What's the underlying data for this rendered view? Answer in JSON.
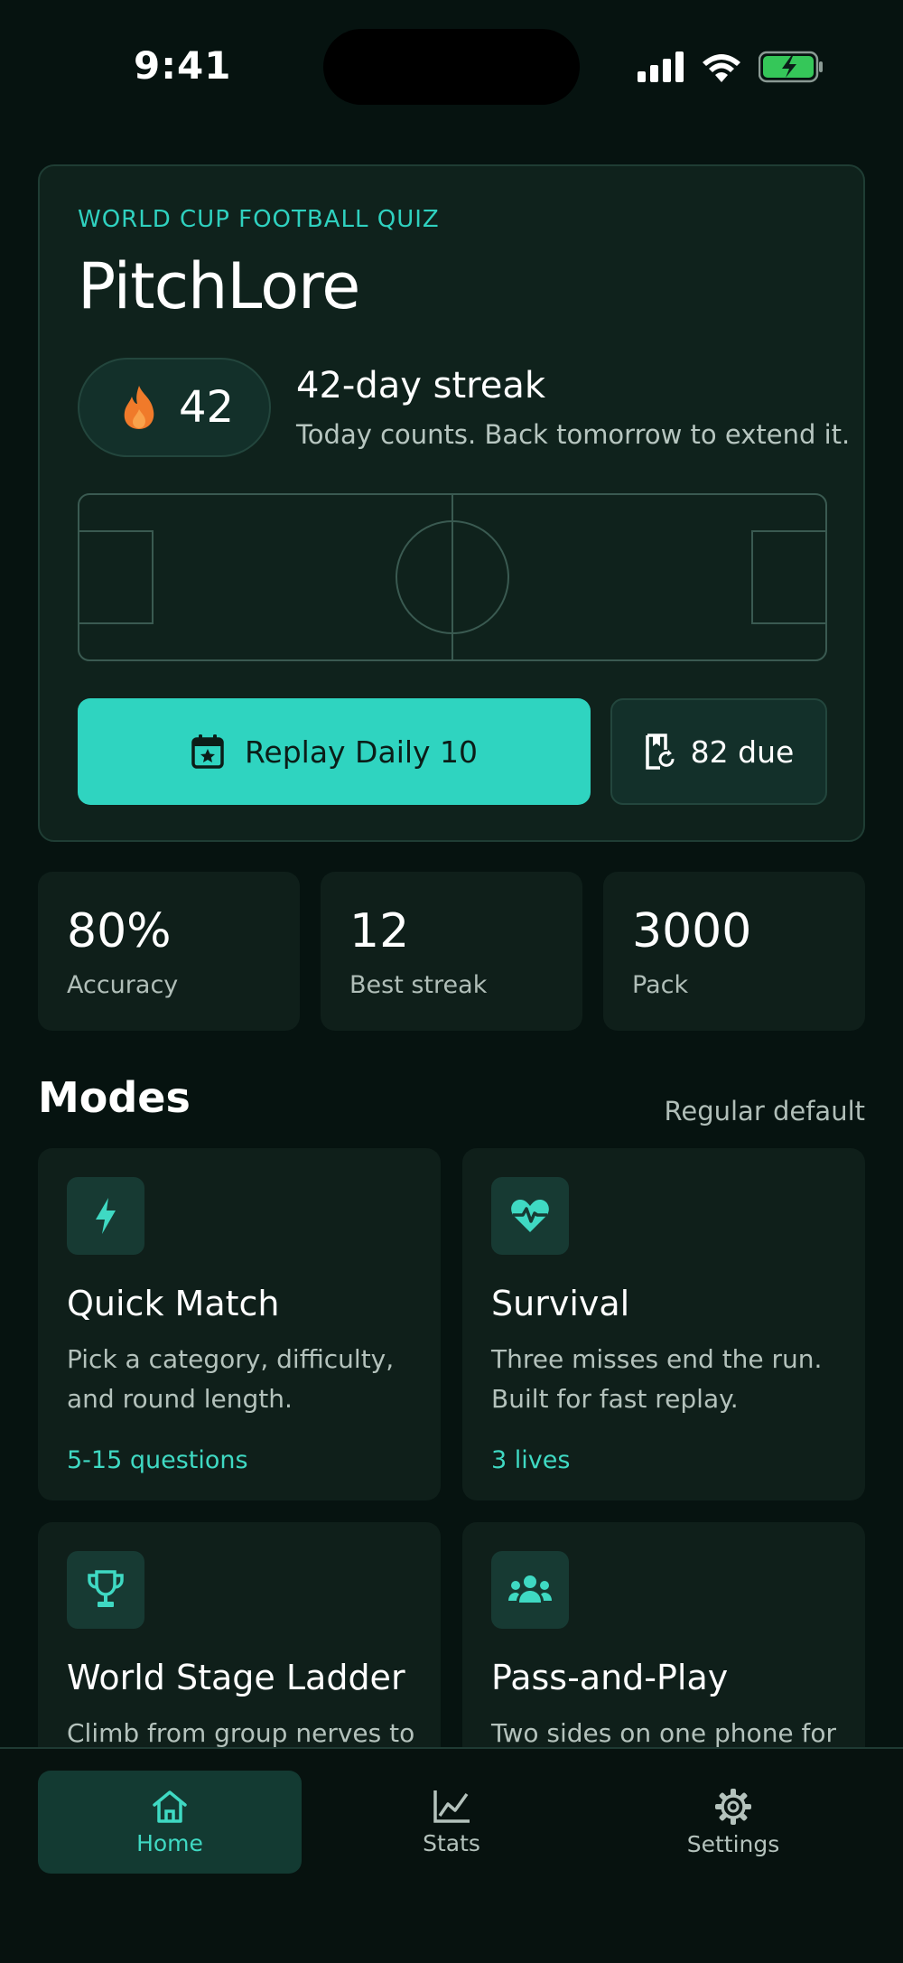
{
  "status_bar": {
    "time": "9:41"
  },
  "hero": {
    "eyebrow": "WORLD CUP FOOTBALL QUIZ",
    "title": "PitchLore",
    "streak": {
      "count": "42",
      "title": "42-day streak",
      "subtitle": "Today counts. Back tomorrow to extend it."
    },
    "primary_button": "Replay Daily 10",
    "due_button": "82 due"
  },
  "stats": [
    {
      "value": "80%",
      "label": "Accuracy"
    },
    {
      "value": "12",
      "label": "Best streak"
    },
    {
      "value": "3000",
      "label": "Pack"
    }
  ],
  "modes": {
    "title": "Modes",
    "meta": "Regular default",
    "items": [
      {
        "name": "Quick Match",
        "desc": "Pick a category, difficulty, and round length.",
        "tag": "5-15 questions",
        "icon": "bolt-icon"
      },
      {
        "name": "Survival",
        "desc": "Three misses end the run. Built for fast replay.",
        "tag": "3 lives",
        "icon": "heart-pulse-icon"
      },
      {
        "name": "World Stage Ladder",
        "desc": "Climb from group nerves to",
        "tag": "",
        "icon": "trophy-icon"
      },
      {
        "name": "Pass-and-Play",
        "desc": "Two sides on one phone for",
        "tag": "",
        "icon": "people-icon"
      }
    ]
  },
  "tabbar": {
    "tabs": [
      {
        "label": "Home",
        "icon": "home-icon",
        "active": true
      },
      {
        "label": "Stats",
        "icon": "chart-icon",
        "active": false
      },
      {
        "label": "Settings",
        "icon": "gear-icon",
        "active": false
      }
    ]
  },
  "colors": {
    "background": "#061310",
    "accent": "#2fd4c0",
    "card": "#0f1f1a",
    "flame": "#f07a2a"
  }
}
